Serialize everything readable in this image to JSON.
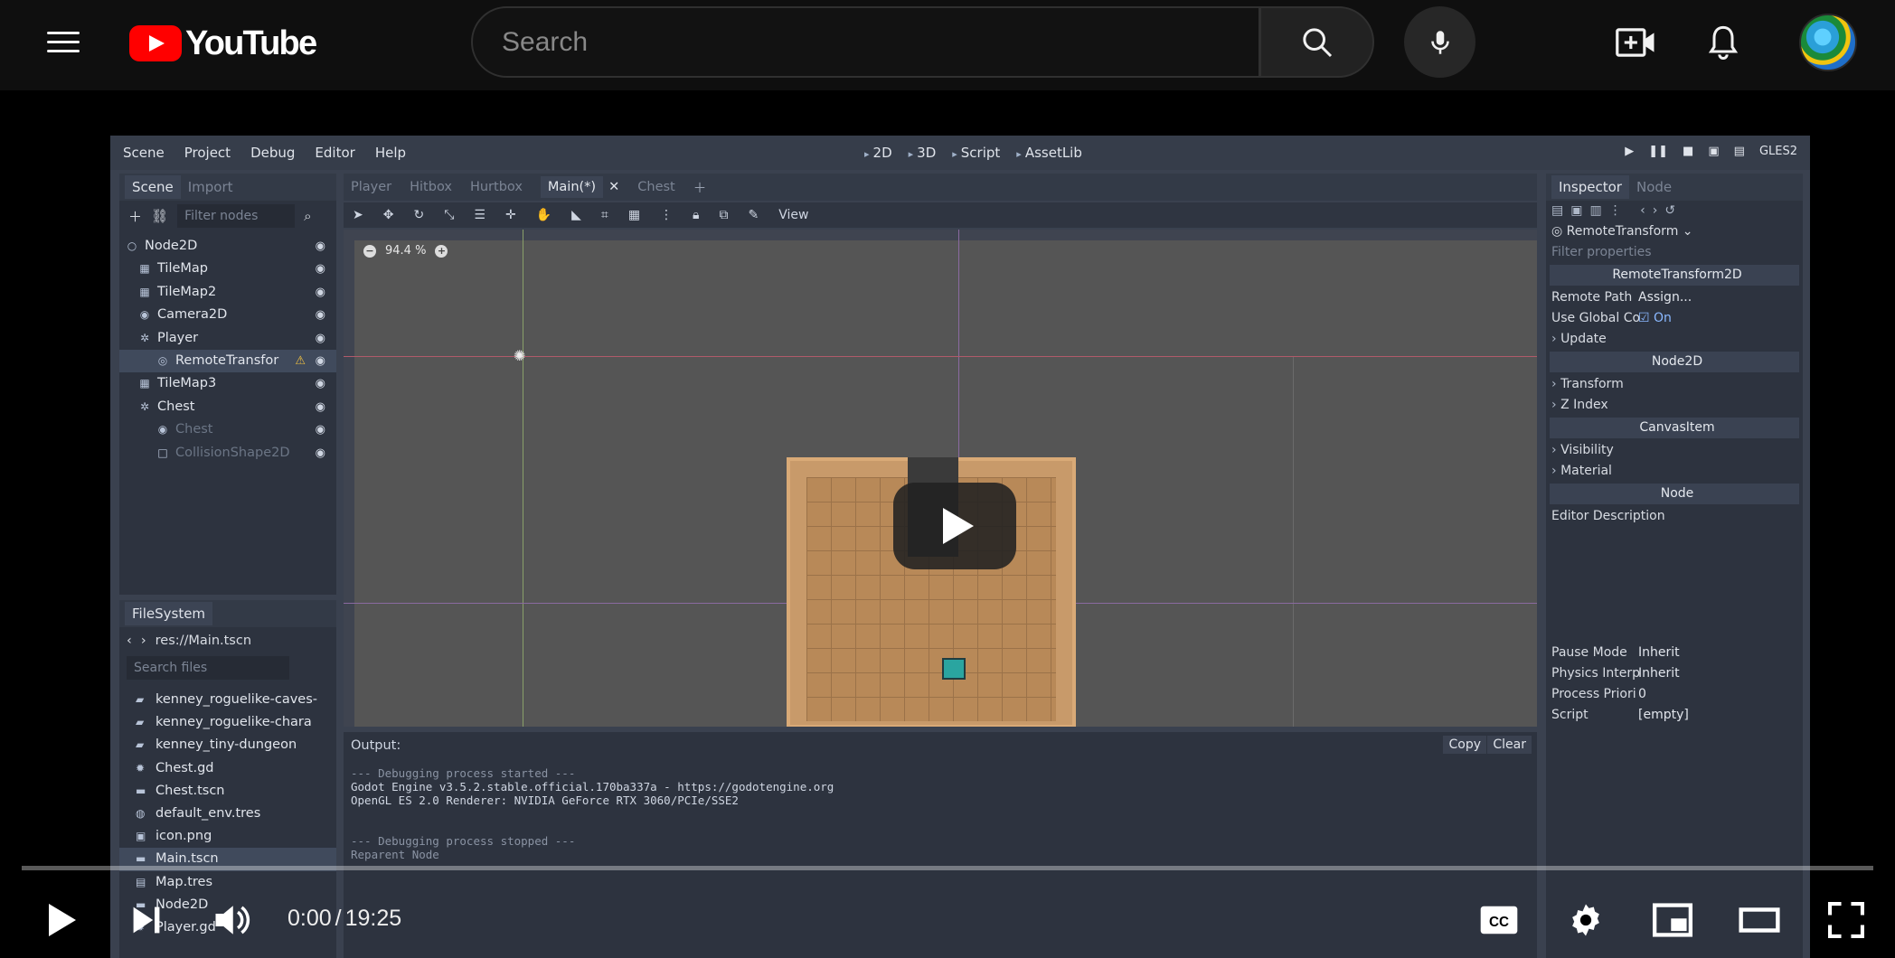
{
  "header": {
    "logo_text": "YouTube",
    "search_placeholder": "Search"
  },
  "player": {
    "current_time": "0:00",
    "separator": "/",
    "duration": "19:25",
    "progress": 0.0
  },
  "godot": {
    "menu": [
      "Scene",
      "Project",
      "Debug",
      "Editor",
      "Help"
    ],
    "workspaces": [
      "2D",
      "3D",
      "Script",
      "AssetLib"
    ],
    "renderer": "GLES2",
    "scene_dock_tabs": [
      "Scene",
      "Import"
    ],
    "filter_nodes_placeholder": "Filter nodes",
    "scene_tree": [
      {
        "name": "Node2D",
        "icon": "○"
      },
      {
        "name": "TileMap",
        "icon": "▦"
      },
      {
        "name": "TileMap2",
        "icon": "▦"
      },
      {
        "name": "Camera2D",
        "icon": "◉"
      },
      {
        "name": "Player",
        "icon": "✲"
      },
      {
        "name": "RemoteTransfor",
        "icon": "◎"
      },
      {
        "name": "TileMap3",
        "icon": "▦"
      },
      {
        "name": "Chest",
        "icon": "✲"
      },
      {
        "name": "Chest",
        "icon": "◉"
      },
      {
        "name": "CollisionShape2D",
        "icon": "□"
      }
    ],
    "filesystem_tab": "FileSystem",
    "fs_path": "res://Main.tscn",
    "search_files_placeholder": "Search files",
    "files": [
      "kenney_roguelike-caves-",
      "kenney_roguelike-chara",
      "kenney_tiny-dungeon",
      "Chest.gd",
      "Chest.tscn",
      "default_env.tres",
      "icon.png",
      "Main.tscn",
      "Map.tres",
      "Node2D",
      "Player.gd"
    ],
    "scene_tabs": [
      "Player",
      "Hitbox",
      "Hurtbox",
      "Main(*)",
      "Chest"
    ],
    "view_menu": "View",
    "zoom": "94.4 %",
    "output": {
      "title": "Output:",
      "copy": "Copy",
      "clear": "Clear",
      "lines": [
        "--- Debugging process started ---",
        "Godot Engine v3.5.2.stable.official.170ba337a - https://godotengine.org",
        "OpenGL ES 2.0 Renderer: NVIDIA GeForce RTX 3060/PCIe/SSE2",
        "",
        "--- Debugging process stopped ---",
        "Reparent Node"
      ]
    },
    "inspector": {
      "tabs": [
        "Inspector",
        "Node"
      ],
      "node_selector": "RemoteTransform",
      "filter_placeholder": "Filter properties",
      "class_header": "RemoteTransform2D",
      "remote_path_label": "Remote Path",
      "remote_path_value": "Assign...",
      "use_global_label": "Use Global Co",
      "use_global_value": "On",
      "update": "Update",
      "node2d": "Node2D",
      "transform": "Transform",
      "z_index": "Z Index",
      "canvas_item": "CanvasItem",
      "visibility": "Visibility",
      "material": "Material",
      "node": "Node",
      "editor_description": "Editor Description",
      "pause_mode_label": "Pause Mode",
      "pause_mode_value": "Inherit",
      "physics_label": "Physics Interp",
      "physics_value": "Inherit",
      "process_label": "Process Priori",
      "process_value": "0",
      "script_label": "Script",
      "script_value": "[empty]"
    }
  }
}
